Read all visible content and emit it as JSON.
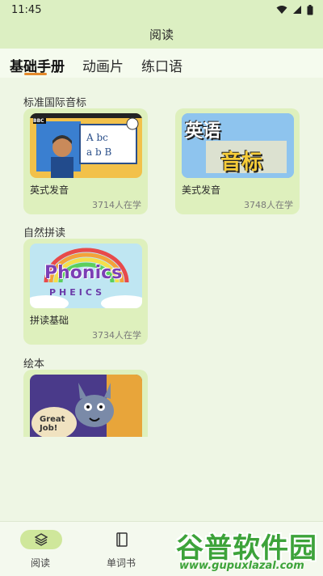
{
  "status": {
    "time": "11:45"
  },
  "appbar": {
    "title": "阅读"
  },
  "tabs": [
    {
      "label": "基础手册"
    },
    {
      "label": "动画片"
    },
    {
      "label": "练口语"
    }
  ],
  "sections": [
    {
      "title": "标准国际音标",
      "cards": [
        {
          "title": "英式发音",
          "count": "3714人在学",
          "thumb_text": "BBC"
        },
        {
          "title": "美式发音",
          "count": "3748人在学",
          "thumb_text_top": "英语",
          "thumb_text_bottom": "音标"
        }
      ]
    },
    {
      "title": "自然拼读",
      "cards": [
        {
          "title": "拼读基础",
          "count": "3734人在学",
          "thumb_text": "Phonics",
          "thumb_sub": "PHEICS"
        }
      ]
    },
    {
      "title": "绘本",
      "cards": [
        {
          "thumb_text": "Great Job!"
        }
      ]
    }
  ],
  "bottomnav": [
    {
      "label": "阅读",
      "icon": "layers-icon"
    },
    {
      "label": "单词书",
      "icon": "book-icon"
    }
  ],
  "watermark": {
    "big": "谷普软件园",
    "small": "www.gupuxlazal.com"
  },
  "colors": {
    "accent": "#e58a2b",
    "card_bg": "#def0bd",
    "appbar_bg": "#dcefc2",
    "nav_active": "#cfe79b"
  }
}
